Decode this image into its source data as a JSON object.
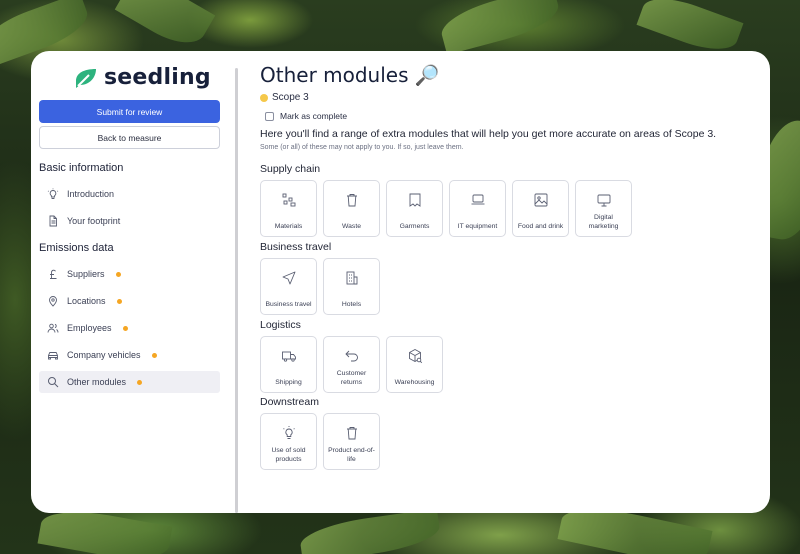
{
  "brand": {
    "name": "seedling",
    "accent": "#3b63e0",
    "logo_color": "#2db37e",
    "dot_color": "#f5a623"
  },
  "sidebar": {
    "submit_label": "Submit for review",
    "back_label": "Back to measure",
    "sections": [
      {
        "title": "Basic information",
        "items": [
          {
            "label": "Introduction",
            "icon": "lightbulb-icon",
            "dot": false
          },
          {
            "label": "Your footprint",
            "icon": "document-icon",
            "dot": false
          }
        ]
      },
      {
        "title": "Emissions data",
        "items": [
          {
            "label": "Suppliers",
            "icon": "pound-icon",
            "dot": true
          },
          {
            "label": "Locations",
            "icon": "location-pin-icon",
            "dot": true
          },
          {
            "label": "Employees",
            "icon": "users-icon",
            "dot": true
          },
          {
            "label": "Company vehicles",
            "icon": "car-icon",
            "dot": true
          },
          {
            "label": "Other modules",
            "icon": "search-icon",
            "dot": true,
            "active": true
          }
        ]
      }
    ]
  },
  "main": {
    "title": "Other modules 🔎",
    "scope": "Scope 3",
    "mark_complete": "Mark as complete",
    "intro": "Here you'll find a range of extra modules that will help you get more accurate on areas of Scope 3.",
    "note": "Some (or all) of these may not apply to you. If so, just leave them.",
    "groups": [
      {
        "title": "Supply chain",
        "cards": [
          {
            "label": "Materials",
            "icon": "materials-icon"
          },
          {
            "label": "Waste",
            "icon": "trash-icon"
          },
          {
            "label": "Garments",
            "icon": "garment-icon"
          },
          {
            "label": "IT equipment",
            "icon": "laptop-icon"
          },
          {
            "label": "Food and drink",
            "icon": "image-icon"
          },
          {
            "label": "Digital marketing",
            "icon": "monitor-icon"
          }
        ]
      },
      {
        "title": "Business travel",
        "cards": [
          {
            "label": "Business travel",
            "icon": "navigation-icon"
          },
          {
            "label": "Hotels",
            "icon": "building-icon"
          }
        ]
      },
      {
        "title": "Logistics",
        "cards": [
          {
            "label": "Shipping",
            "icon": "truck-icon"
          },
          {
            "label": "Customer returns",
            "icon": "return-arrow-icon"
          },
          {
            "label": "Warehousing",
            "icon": "package-search-icon"
          }
        ]
      },
      {
        "title": "Downstream",
        "cards": [
          {
            "label": "Use of sold products",
            "icon": "lightbulb-icon"
          },
          {
            "label": "Product end-of-life",
            "icon": "trash-icon"
          }
        ]
      }
    ]
  }
}
